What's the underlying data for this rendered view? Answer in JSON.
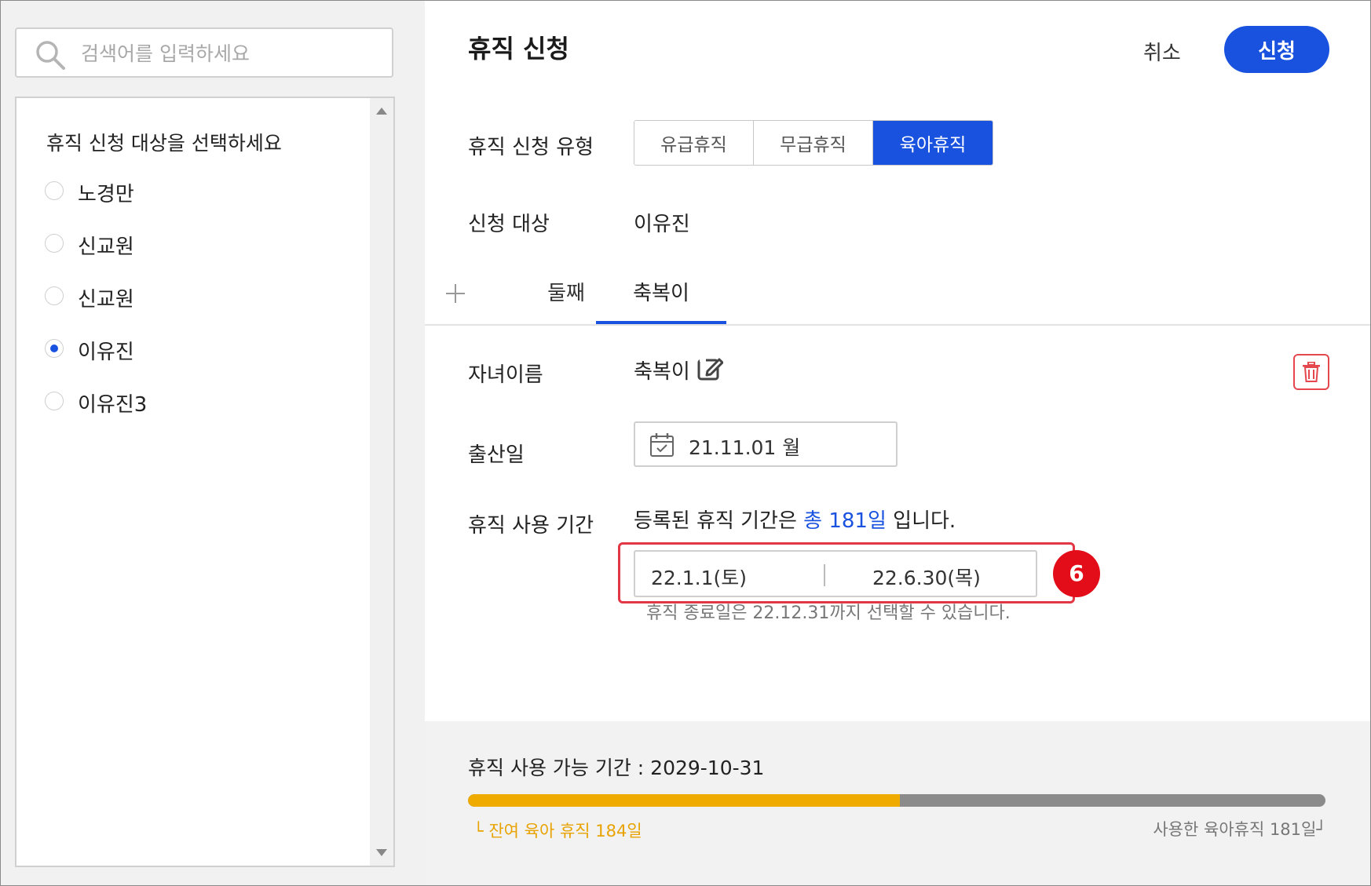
{
  "search": {
    "placeholder": "검색어를 입력하세요",
    "icon": "search-icon"
  },
  "employee_list": {
    "heading": "휴직 신청 대상을 선택하세요",
    "items": [
      {
        "label": "노경만",
        "checked": false
      },
      {
        "label": "신교원",
        "checked": false
      },
      {
        "label": "신교원",
        "checked": false
      },
      {
        "label": "이유진",
        "checked": true
      },
      {
        "label": "이유진3",
        "checked": false
      }
    ]
  },
  "header": {
    "title": "휴직 신청",
    "cancel_label": "취소",
    "apply_label": "신청"
  },
  "leave_type": {
    "label": "휴직 신청 유형",
    "options": [
      "유급휴직",
      "무급휴직",
      "육아휴직"
    ],
    "selected": "육아휴직"
  },
  "target": {
    "label": "신청 대상",
    "value": "이유진"
  },
  "child_tabs": {
    "tabs": [
      "둘째",
      "축복이"
    ],
    "active": "축복이"
  },
  "child": {
    "name_label": "자녀이름",
    "name_value": "축복이",
    "birth_label": "출산일",
    "birth_date": "21.11.01 월"
  },
  "period": {
    "label": "휴직 사용 기간",
    "desc_prefix": "등록된 휴직 기간은 ",
    "desc_highlight": "총 181일",
    "desc_suffix": " 입니다.",
    "start": "22.1.1(토)",
    "end": "22.6.30(목)",
    "step_badge": "6",
    "note": "휴직 종료일은 22.12.31까지 선택할 수 있습니다."
  },
  "usage": {
    "available": "휴직 사용 가능 기간 : 2029-10-31",
    "remaining_label": "└ 잔여 육아 휴직 184일",
    "used_label": "사용한 육아휴직 181일┘",
    "remaining_days": 184,
    "used_days": 181
  },
  "colors": {
    "accent": "#1a52e0",
    "warning": "#f0ab00",
    "danger": "#e30d1a"
  }
}
